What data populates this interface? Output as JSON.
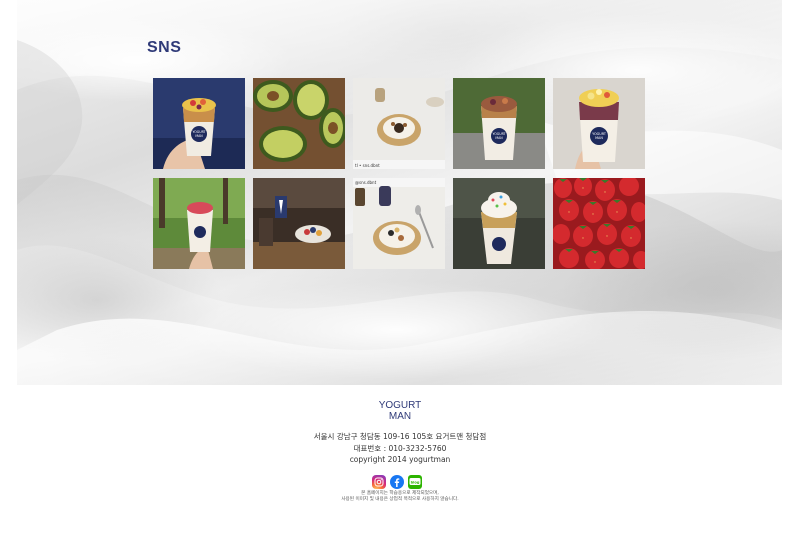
{
  "section": {
    "title": "SNS"
  },
  "gallery": {
    "tiles": [
      {
        "icon": "yogurt-cup-photo"
      },
      {
        "icon": "avocado-photo"
      },
      {
        "icon": "granola-bowl-photo"
      },
      {
        "icon": "fig-yogurt-cup-photo"
      },
      {
        "icon": "fruit-yogurt-cup-photo"
      },
      {
        "icon": "park-yogurt-cup-photo"
      },
      {
        "icon": "shop-interior-photo"
      },
      {
        "icon": "nut-bowl-photo"
      },
      {
        "icon": "sprinkle-yogurt-cup-photo"
      },
      {
        "icon": "strawberries-photo"
      }
    ],
    "tile3_overlay": "tl • sns.dbnt",
    "tile8_overlay": "@sns.dbnt"
  },
  "brand": {
    "logo_top": "YOGURT",
    "logo_bottom": "MAN",
    "logo_color": "#2f3a78"
  },
  "footer": {
    "address": "서울시 강남구 청담동 109-16 105호 요거트맨 청담점",
    "phone": "대표번호 : 010-3232-5760",
    "copyright": "copyright 2014 yogurtman",
    "social": [
      {
        "icon": "instagram-icon",
        "color": "#d62a7b"
      },
      {
        "icon": "facebook-icon",
        "color": "#1877f2"
      },
      {
        "icon": "blog-icon",
        "color": "#2db400",
        "label": "blog"
      }
    ],
    "note_line1": "본 홈페이지는 학습용으로 제작되었으며,",
    "note_line2": "사용된 이미지 및 내용은 상업적 목적으로 사용하지 않습니다."
  }
}
